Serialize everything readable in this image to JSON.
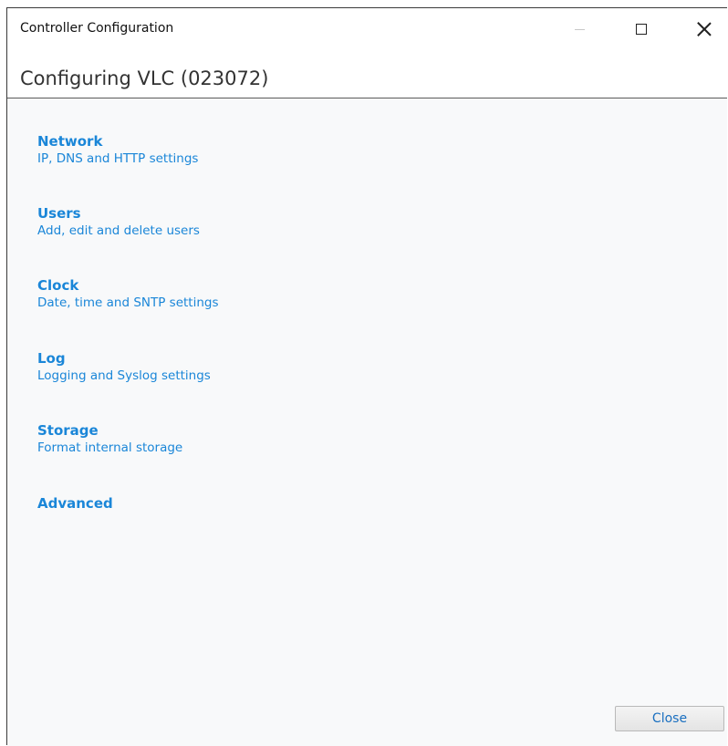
{
  "window": {
    "title": "Controller Configuration"
  },
  "header": {
    "title": "Configuring VLC (023072)"
  },
  "menu": {
    "items": [
      {
        "label": "Network",
        "desc": "IP, DNS and HTTP settings"
      },
      {
        "label": "Users",
        "desc": "Add, edit and delete users"
      },
      {
        "label": "Clock",
        "desc": "Date, time and SNTP settings"
      },
      {
        "label": "Log",
        "desc": "Logging and Syslog settings"
      },
      {
        "label": "Storage",
        "desc": "Format internal storage"
      },
      {
        "label": "Advanced",
        "desc": ""
      }
    ]
  },
  "footer": {
    "close_label": "Close"
  },
  "colors": {
    "accent": "#1a86d8",
    "background": "#f8f9fa"
  },
  "icons": {
    "minimize": "minimize-icon",
    "maximize": "maximize-icon",
    "close": "close-icon"
  }
}
